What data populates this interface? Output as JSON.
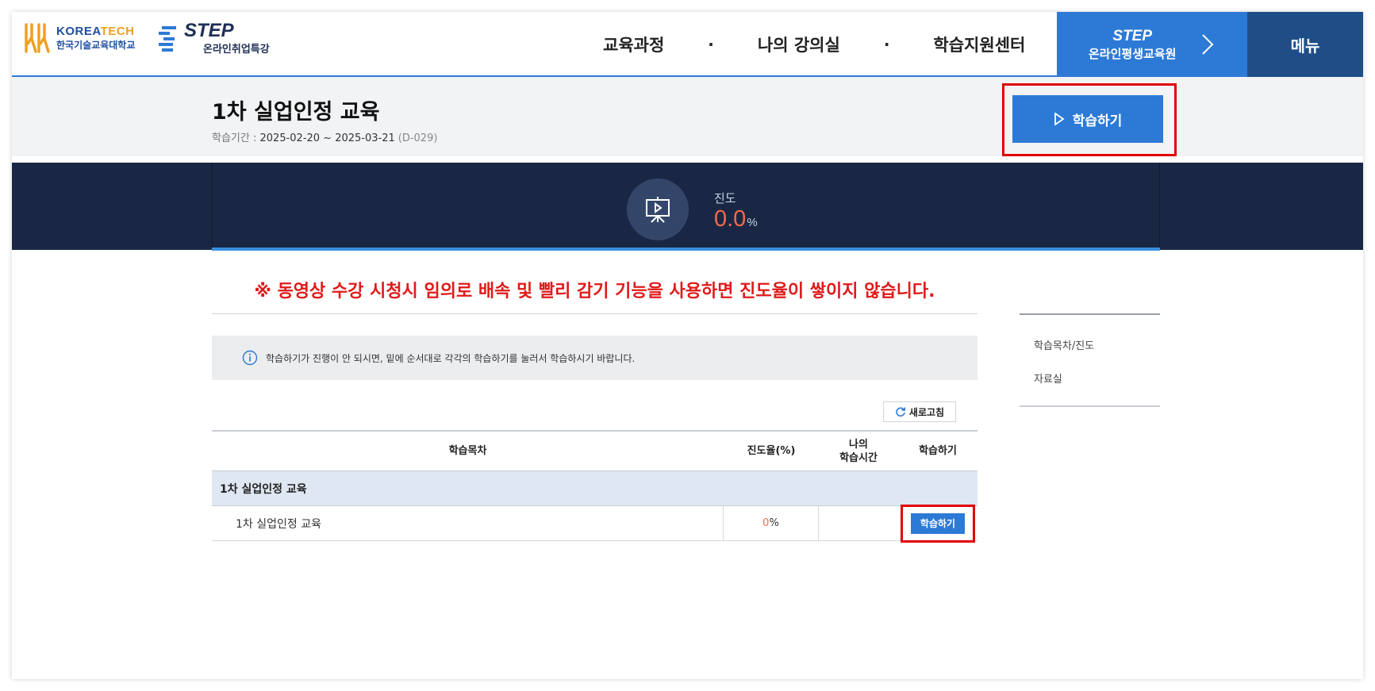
{
  "header": {
    "koreatech": {
      "name_prefix": "KOREA",
      "name_suffix": "TECH",
      "sub": "한국기술교육대학교"
    },
    "step": {
      "name": "STEP",
      "sub": "온라인취업특강"
    },
    "nav": [
      "교육과정",
      "나의 강의실",
      "학습지원센터"
    ],
    "nav_separator": "·",
    "step_link": {
      "logo": "STEP",
      "label": "온라인평생교육원"
    },
    "menu_label": "메뉴",
    "accent_color": "#2d7ad6",
    "menu_color": "#1f4e86"
  },
  "course": {
    "title": "1차 실업인정 교육",
    "period_label": "학습기간 : ",
    "period": "2025-02-20 ~ 2025-03-21",
    "dday": "(D-029)",
    "study_button": "학습하기"
  },
  "progress": {
    "label": "진도",
    "value": "0.0",
    "unit": "%",
    "band_color": "#1a2744"
  },
  "warning": "※ 동영상 수강 시청시 임의로 배속 및 빨리 감기 기능을 사용하면 진도율이 쌓이지 않습니다.",
  "info": "학습하기가 진행이 안 되시면, 밑에 순서대로 각각의 학습하기를 눌러서 학습하시기 바랍니다.",
  "refresh_label": "새로고침",
  "table": {
    "headers": [
      "학습목차",
      "진도율(%)",
      "나의\n학습시간",
      "학습하기"
    ],
    "header_mytime_line1": "나의",
    "header_mytime_line2": "학습시간",
    "group": "1차 실업인정 교육",
    "rows": [
      {
        "title": "1차 실업인정 교육",
        "progress_num": "0",
        "progress_unit": "%",
        "time": "",
        "button": "학습하기"
      }
    ]
  },
  "side_nav": [
    "학습목차/진도",
    "자료실"
  ]
}
